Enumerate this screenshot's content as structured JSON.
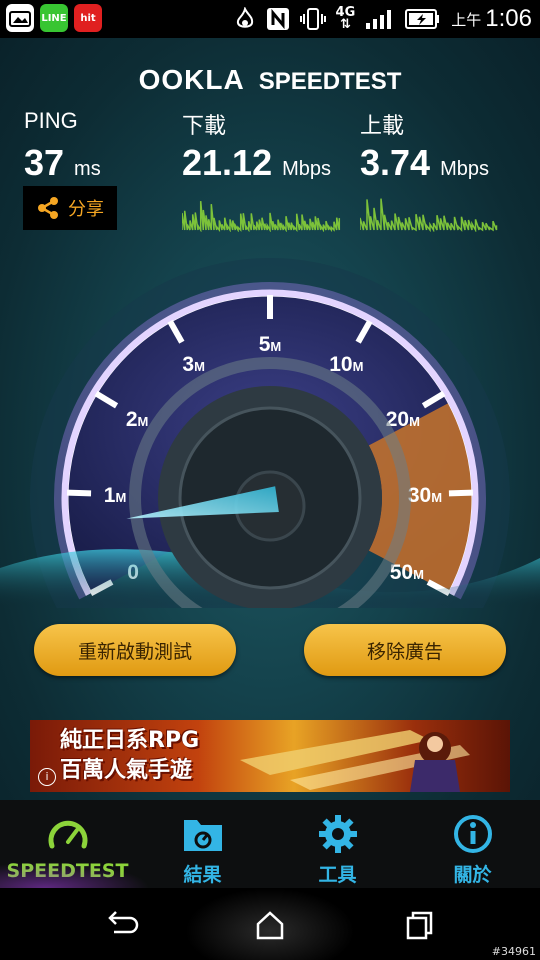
{
  "status_bar": {
    "apps": [
      {
        "icon": "gallery-icon",
        "label": ""
      },
      {
        "icon": "line-icon",
        "label": "LINE"
      },
      {
        "icon": "hitfm-icon",
        "label": "hit"
      }
    ],
    "network": "4G",
    "ampm": "上午",
    "time": "1:06"
  },
  "header": {
    "brand": "OOKLA",
    "product": "SPEEDTEST"
  },
  "stats": {
    "ping": {
      "label": "PING",
      "value": "37",
      "unit": "ms"
    },
    "download": {
      "label": "下載",
      "value": "21.12",
      "unit": "Mbps"
    },
    "upload": {
      "label": "上載",
      "value": "3.74",
      "unit": "Mbps"
    }
  },
  "share": {
    "label": "分享",
    "icon": "share-icon"
  },
  "gauge": {
    "ticks": [
      {
        "num": "0",
        "unit": ""
      },
      {
        "num": "1",
        "unit": "M"
      },
      {
        "num": "2",
        "unit": "M"
      },
      {
        "num": "3",
        "unit": "M"
      },
      {
        "num": "5",
        "unit": "M"
      },
      {
        "num": "10",
        "unit": "M"
      },
      {
        "num": "20",
        "unit": "M"
      },
      {
        "num": "30",
        "unit": "M"
      },
      {
        "num": "50",
        "unit": "M"
      }
    ],
    "needle_tick_fraction": 0.2,
    "accent": "#e08a2a"
  },
  "buttons": {
    "retest": "重新啟動測試",
    "remove_ads": "移除廣告"
  },
  "ad": {
    "line1": "純正日系RPG",
    "line2": "百萬人氣手遊",
    "info": "i"
  },
  "tabs": [
    {
      "label": "SPEEDTEST",
      "icon": "speedometer-icon",
      "active": true
    },
    {
      "label": "結果",
      "icon": "folder-icon",
      "active": false
    },
    {
      "label": "工具",
      "icon": "gear-icon",
      "active": false
    },
    {
      "label": "關於",
      "icon": "info-icon",
      "active": false
    }
  ],
  "watermark": "#34961",
  "colors": {
    "accent_green": "#8cd43a",
    "accent_blue": "#33b5e5",
    "button_gold": "#f2b431"
  }
}
